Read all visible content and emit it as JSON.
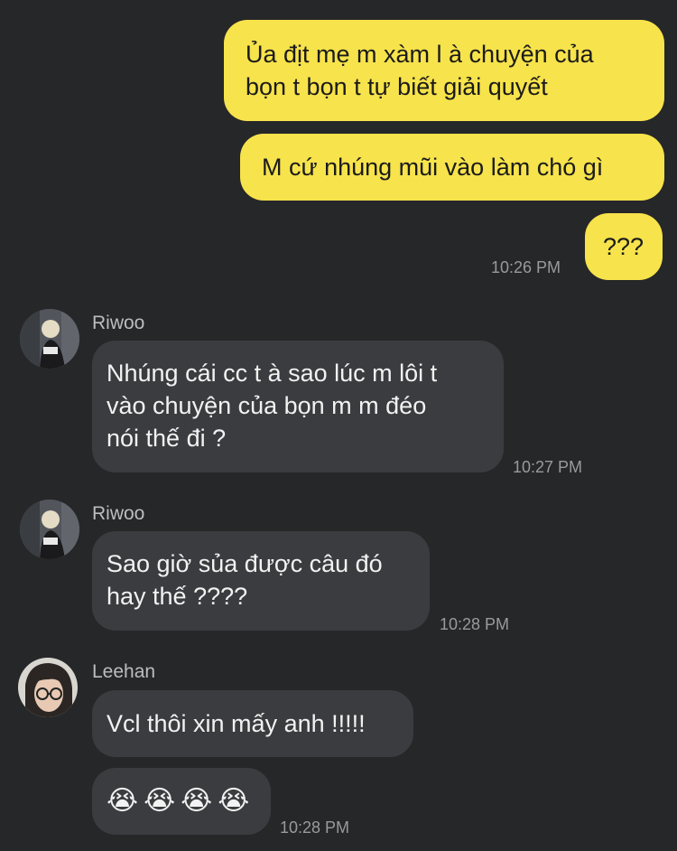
{
  "outgoing": [
    {
      "lines": [
        "Ủa địt mẹ m xàm l à chuyện của",
        "bọn t bọn t tự biết giải quyết"
      ]
    },
    {
      "lines": [
        "M cứ nhúng mũi vào làm chó gì"
      ]
    },
    {
      "lines": [
        "???"
      ],
      "time": "10:26 PM"
    }
  ],
  "incoming": [
    {
      "sender": "Riwoo",
      "lines": [
        "Nhúng cái cc t à sao lúc m lôi t",
        "vào chuyện của bọn m m đéo",
        "nói thế đi ?"
      ],
      "time": "10:27 PM"
    },
    {
      "sender": "Riwoo",
      "lines": [
        "Sao giờ sủa được câu đó",
        "hay thế ????"
      ],
      "time": "10:28 PM"
    },
    {
      "sender": "Leehan",
      "lines": [
        "Vcl thôi xin mấy anh !!!!!"
      ]
    },
    {
      "emojis": [
        "😭",
        "😭",
        "😭",
        "😭"
      ],
      "time": "10:28 PM"
    }
  ],
  "colors": {
    "background": "#262729",
    "outgoing_bubble": "#f7e34b",
    "incoming_bubble": "#3b3c3f"
  }
}
